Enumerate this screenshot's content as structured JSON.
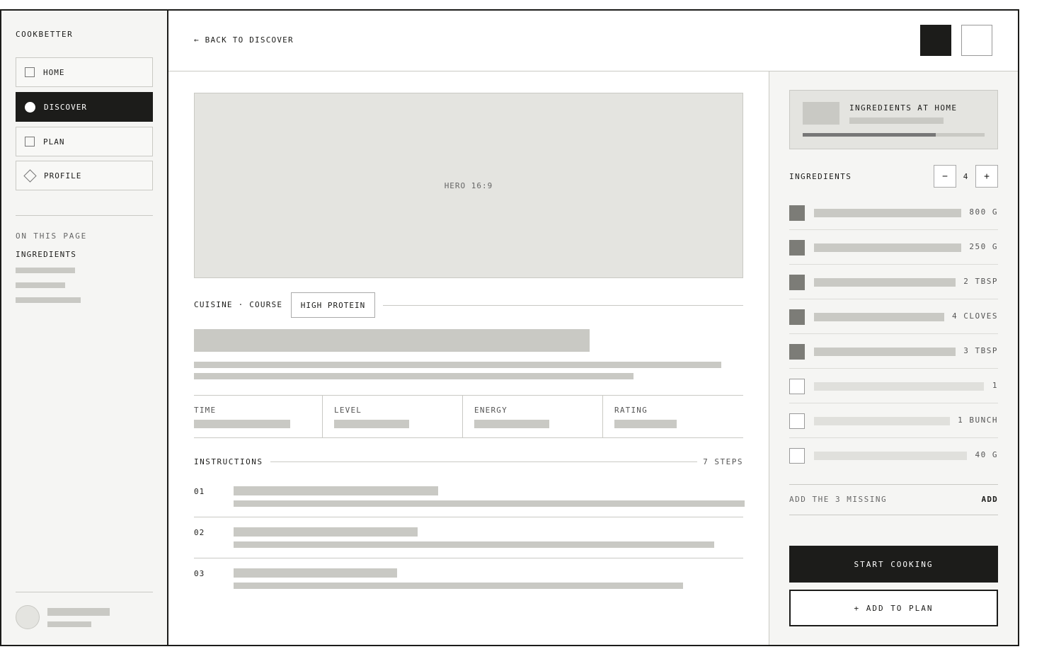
{
  "app": {
    "brand": "COOKBETTER"
  },
  "sidebar": {
    "nav": [
      {
        "label": "HOME",
        "icon": "square-icon",
        "active": false
      },
      {
        "label": "DISCOVER",
        "icon": "circle-icon",
        "active": true
      },
      {
        "label": "PLAN",
        "icon": "square-icon",
        "active": false
      },
      {
        "label": "PROFILE",
        "icon": "diamond-icon",
        "active": false
      }
    ],
    "toc_heading": "ON THIS PAGE",
    "toc_current": "INGREDIENTS"
  },
  "header": {
    "back_label": "← BACK TO DISCOVER"
  },
  "main": {
    "hero_label": "HERO 16:9",
    "meta": "CUISINE · COURSE",
    "tag": "HIGH PROTEIN",
    "stats": [
      "TIME",
      "LEVEL",
      "ENERGY",
      "RATING"
    ],
    "instructions_heading": "INSTRUCTIONS",
    "steps_count": "7 STEPS",
    "steps": [
      "01",
      "02",
      "03"
    ]
  },
  "panel": {
    "home_card_title": "INGREDIENTS AT HOME",
    "home_card_progress": 0.73,
    "ingredients_heading": "INGREDIENTS",
    "stepper": {
      "minus": "−",
      "value": "4",
      "plus": "+"
    },
    "ingredients": [
      {
        "qty": "800 G",
        "have": true
      },
      {
        "qty": "250 G",
        "have": true
      },
      {
        "qty": "2 TBSP",
        "have": true
      },
      {
        "qty": "4 CLOVES",
        "have": true
      },
      {
        "qty": "3 TBSP",
        "have": true
      },
      {
        "qty": "1",
        "have": false
      },
      {
        "qty": "1 BUNCH",
        "have": false
      },
      {
        "qty": "40 G",
        "have": false
      }
    ],
    "missing_text": "ADD THE 3 MISSING",
    "missing_action": "ADD",
    "primary_cta": "START COOKING",
    "secondary_cta": "+ ADD TO PLAN"
  },
  "colors": {
    "ink": "#1c1c1a",
    "placeholder": "#c9c9c4",
    "surface": "#f5f5f3",
    "have_swatch": "#7c7c77"
  }
}
